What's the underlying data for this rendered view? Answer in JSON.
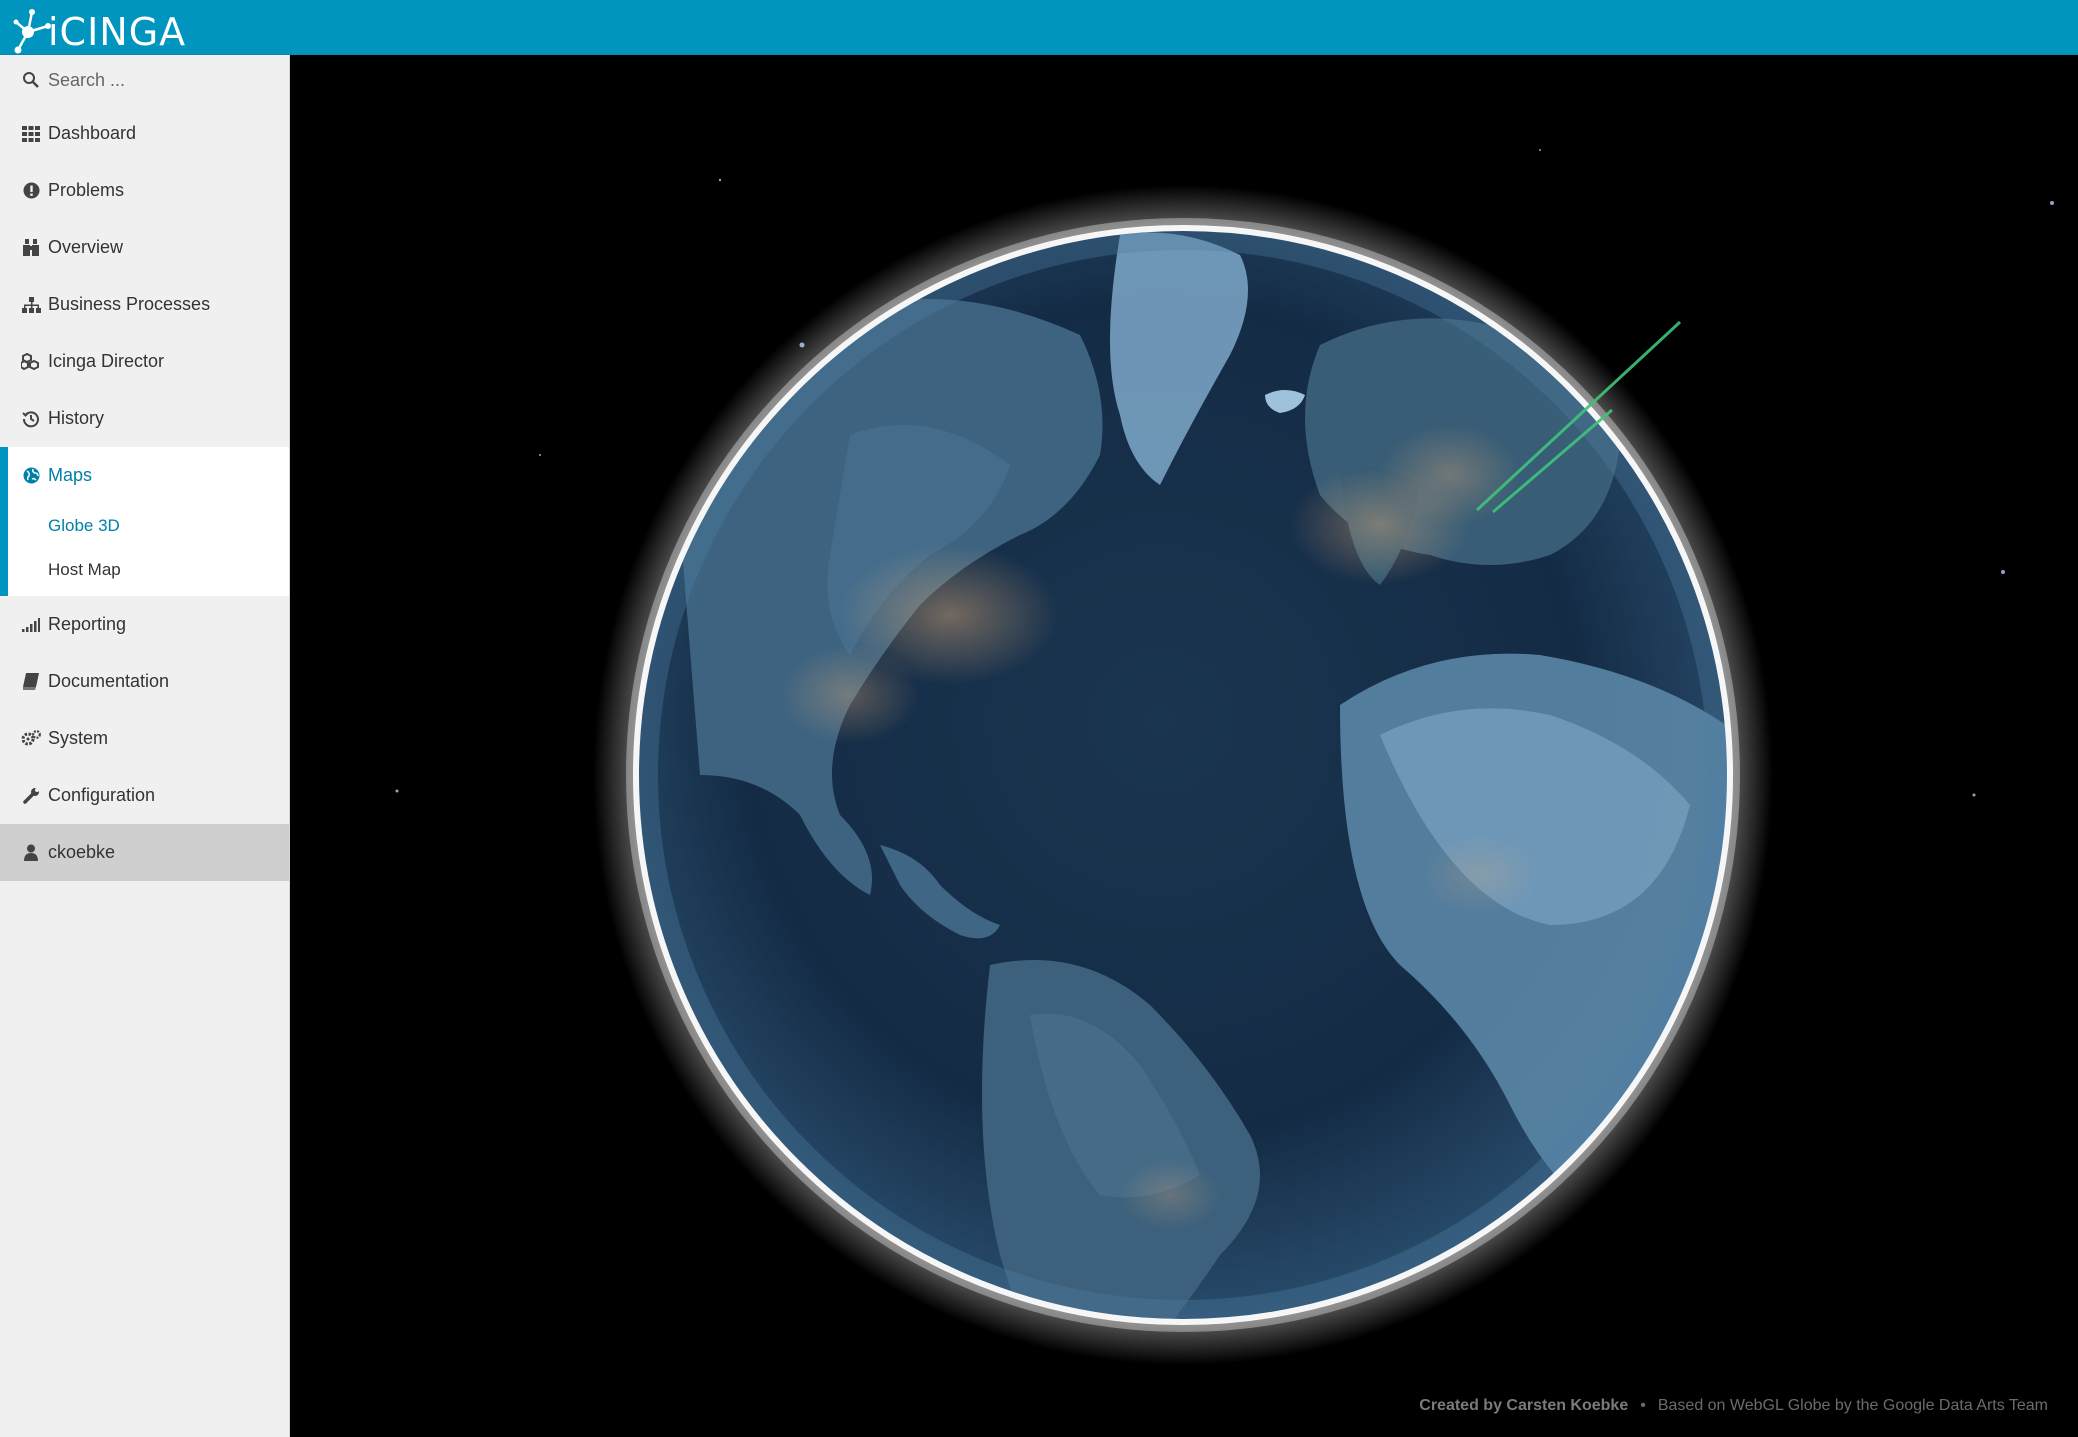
{
  "header": {
    "logo_text": "iCINGA",
    "accent_color": "#0095bf"
  },
  "sidebar": {
    "search_placeholder": "Search ...",
    "items": [
      {
        "label": "Dashboard",
        "icon": "grid-icon"
      },
      {
        "label": "Problems",
        "icon": "exclamation-circle-icon"
      },
      {
        "label": "Overview",
        "icon": "binoculars-icon"
      },
      {
        "label": "Business Processes",
        "icon": "sitemap-icon"
      },
      {
        "label": "Icinga Director",
        "icon": "cubes-icon"
      },
      {
        "label": "History",
        "icon": "history-icon"
      },
      {
        "label": "Maps",
        "icon": "globe-icon",
        "active": true
      },
      {
        "label": "Reporting",
        "icon": "bar-chart-icon"
      },
      {
        "label": "Documentation",
        "icon": "book-icon"
      },
      {
        "label": "System",
        "icon": "gears-icon"
      },
      {
        "label": "Configuration",
        "icon": "wrench-icon"
      }
    ],
    "maps_sub": [
      {
        "label": "Globe 3D",
        "active": true
      },
      {
        "label": "Host Map"
      }
    ],
    "user": {
      "label": "ckoebke",
      "icon": "user-icon"
    }
  },
  "main": {
    "view": "Globe 3D",
    "background_color": "#000000"
  },
  "footer": {
    "created_by": "Created by Carsten Koebke",
    "separator": "•",
    "based_on": "Based on WebGL Globe by the Google Data Arts Team"
  }
}
